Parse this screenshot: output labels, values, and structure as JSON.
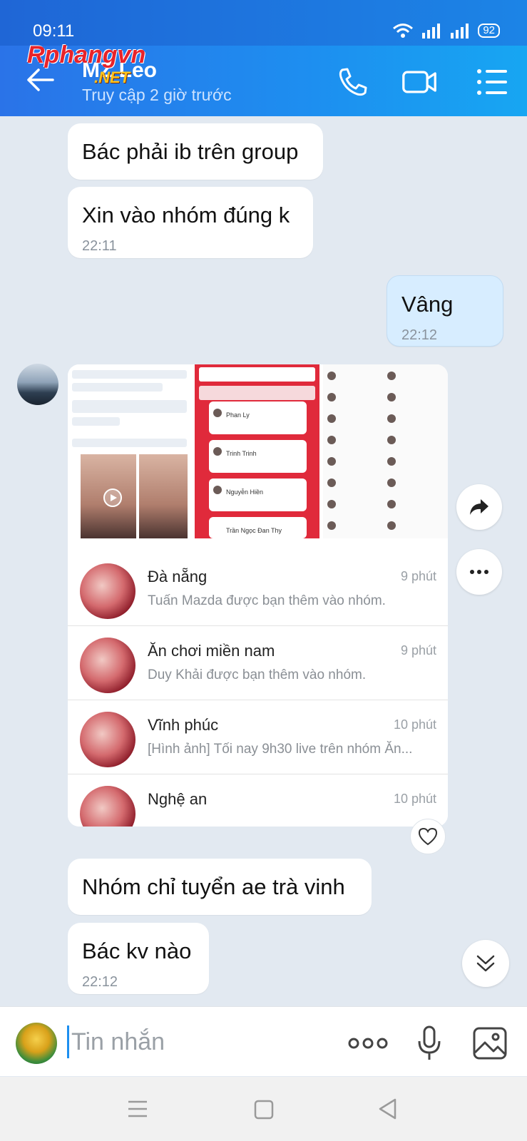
{
  "status": {
    "time": "09:11",
    "battery": "92"
  },
  "header": {
    "name": "MZ Leo",
    "subtitle": "Truy cập 2 giờ trước",
    "watermark": "Rphangvn",
    "watermark_sub": ".NET"
  },
  "messages": {
    "m1": "Bác phải ib trên group",
    "m2": "Xin vào nhóm đúng k",
    "m2_time": "22:11",
    "m3": "Vâng",
    "m3_time": "22:12",
    "m4": "Nhóm chỉ tuyển ae trà vinh",
    "m5": "Bác kv nào",
    "m5_time": "22:12"
  },
  "thumb2_names": [
    "Phan Ly",
    "Trinh Trinh",
    "Nguyễn Hiền",
    "Trần Ngọc Đan Thy"
  ],
  "groups": [
    {
      "name": "Đà nẵng",
      "time": "9 phút",
      "msg": "Tuấn Mazda được bạn thêm vào nhóm."
    },
    {
      "name": "Ăn chơi miền nam",
      "time": "9 phút",
      "msg": "Duy Khải được bạn thêm vào nhóm."
    },
    {
      "name": "Vĩnh phúc",
      "time": "10 phút",
      "msg": "[Hình ảnh] Tối nay 9h30 live trên nhóm Ăn..."
    },
    {
      "name": "Nghệ an",
      "time": "10 phút",
      "msg": ""
    }
  ],
  "input": {
    "placeholder": "Tin nhắn"
  },
  "colors": {
    "header_gradient_start": "#2a73e8",
    "header_gradient_end": "#17a6f2",
    "my_bubble": "#d7edff",
    "chat_bg": "#e2e9f1"
  }
}
